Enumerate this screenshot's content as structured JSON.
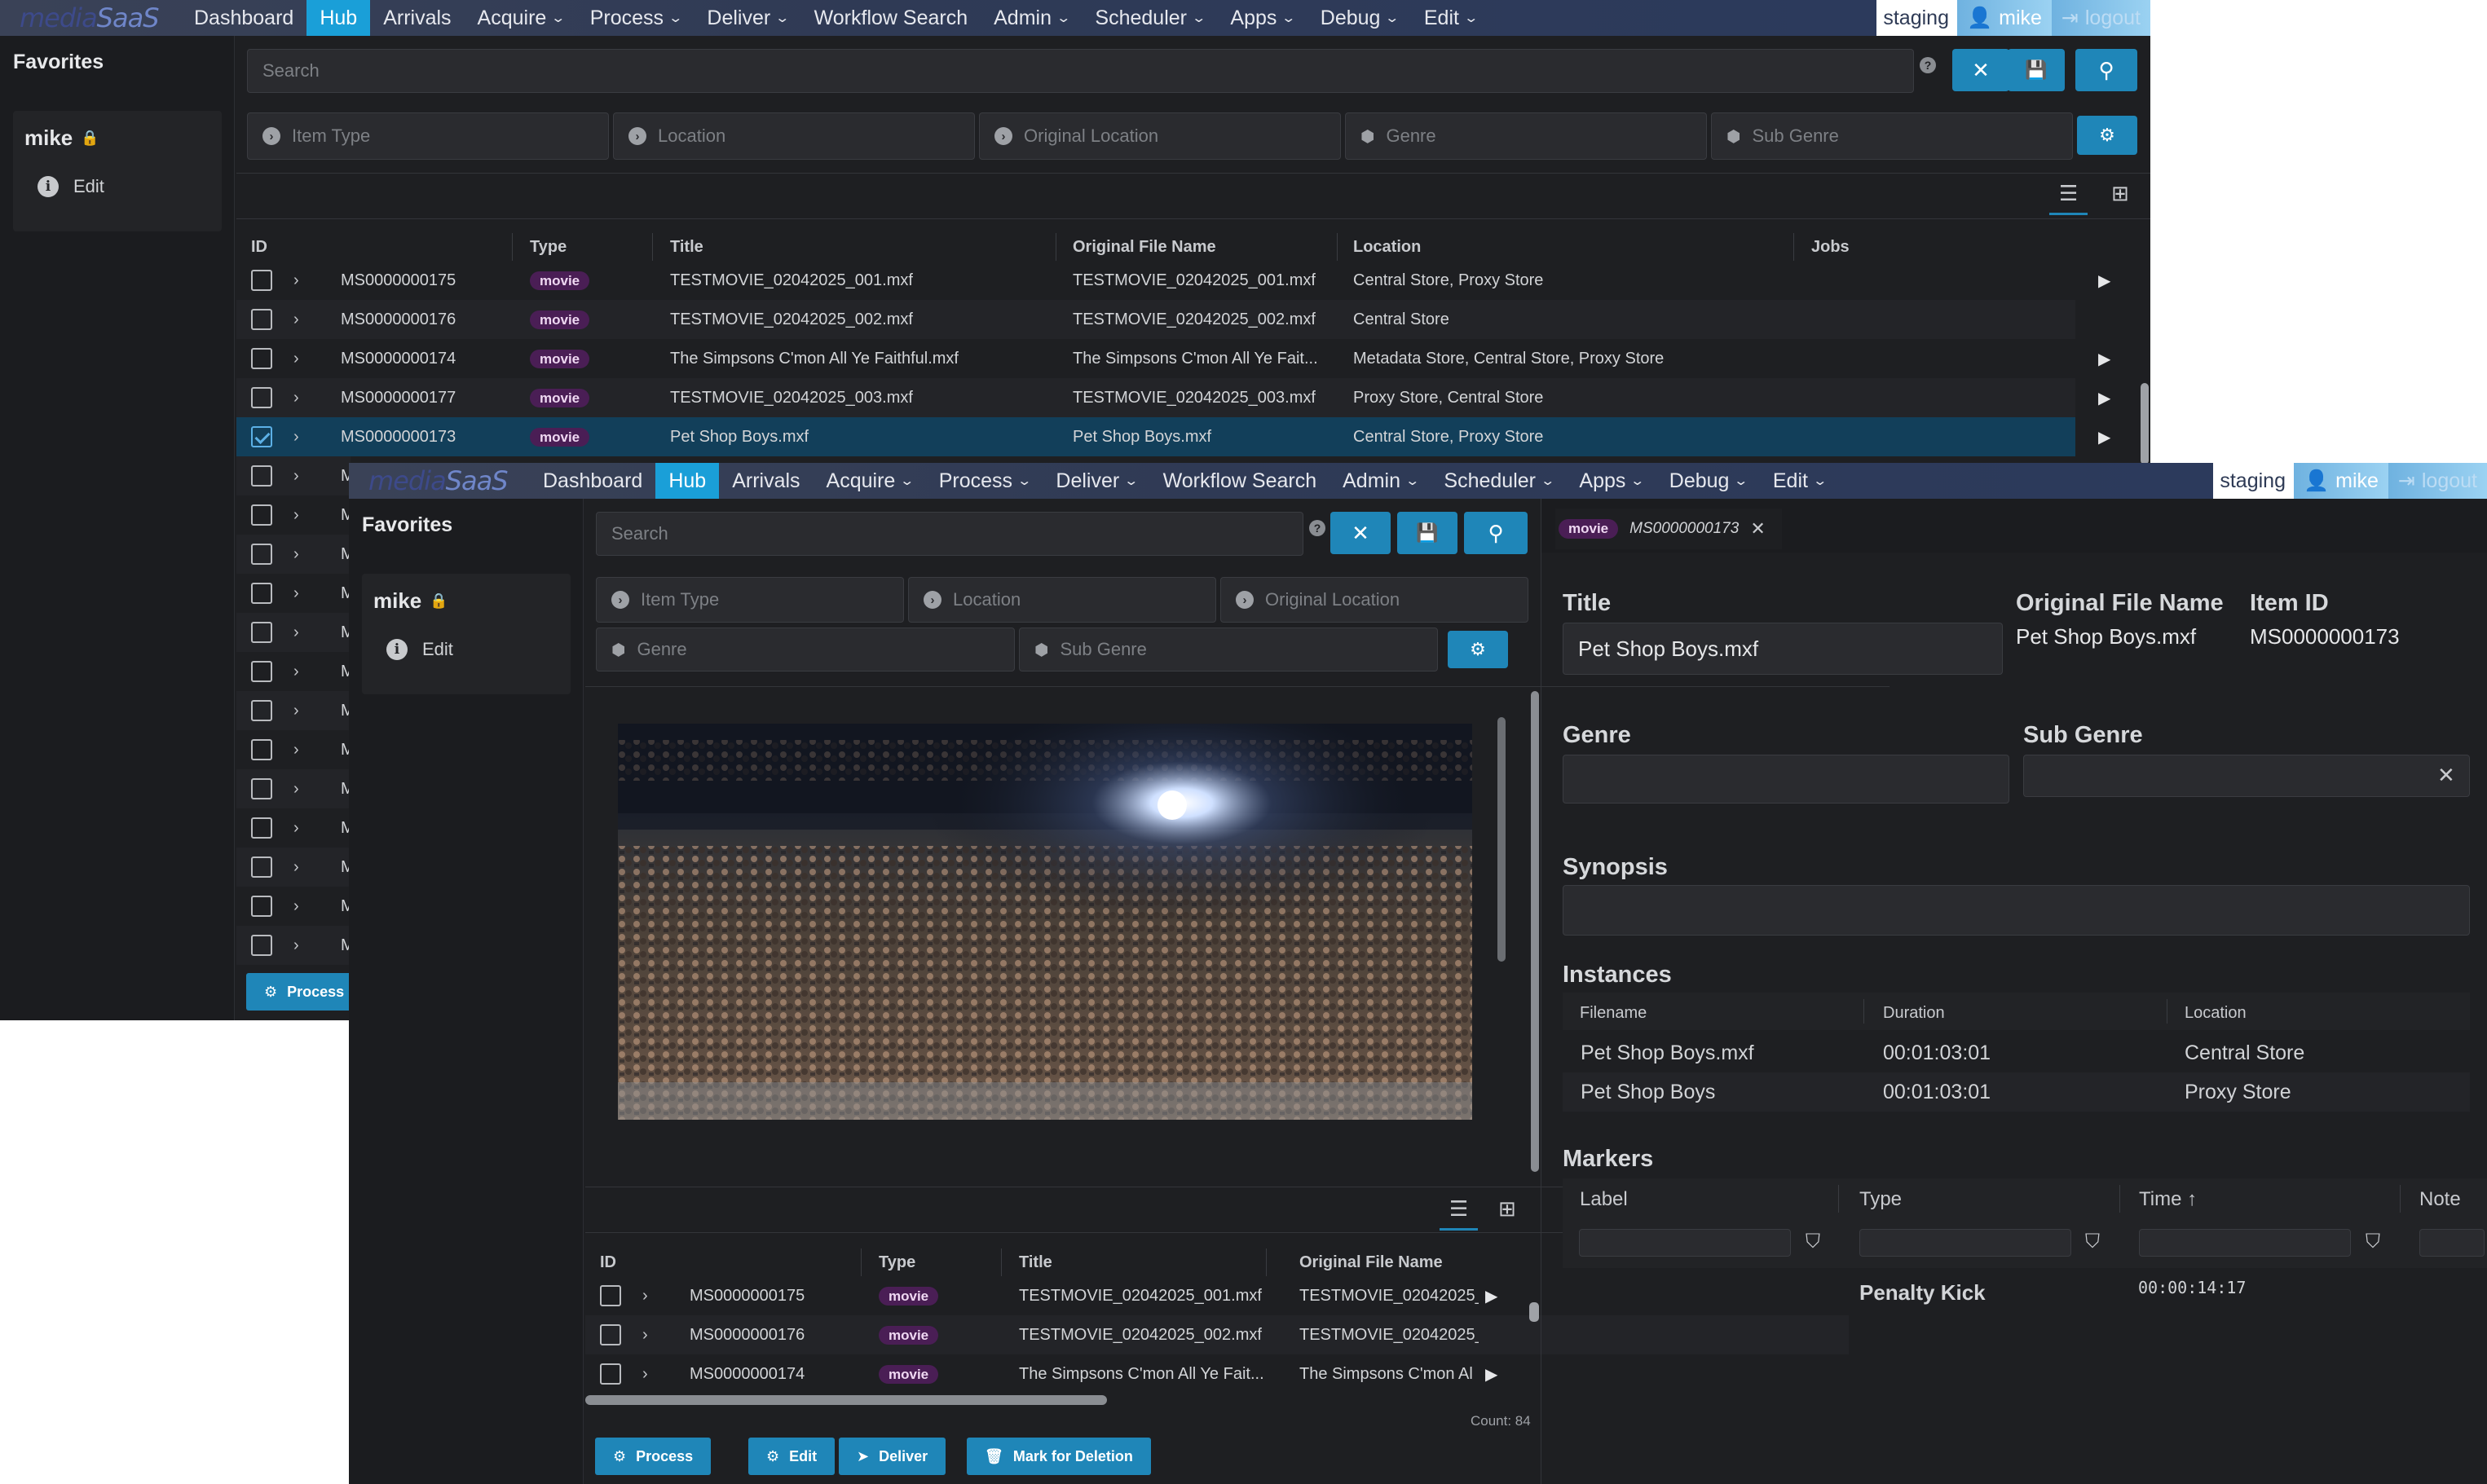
{
  "nav": {
    "logo_part1": "media",
    "logo_part2": "SaaS",
    "items": [
      {
        "label": "Dashboard",
        "has_menu": false
      },
      {
        "label": "Hub",
        "has_menu": false,
        "active": true
      },
      {
        "label": "Arrivals",
        "has_menu": false
      },
      {
        "label": "Acquire",
        "has_menu": true
      },
      {
        "label": "Process",
        "has_menu": true
      },
      {
        "label": "Deliver",
        "has_menu": true
      },
      {
        "label": "Workflow Search",
        "has_menu": false
      },
      {
        "label": "Admin",
        "has_menu": true
      },
      {
        "label": "Scheduler",
        "has_menu": true
      },
      {
        "label": "Apps",
        "has_menu": true
      },
      {
        "label": "Debug",
        "has_menu": true
      },
      {
        "label": "Edit",
        "has_menu": true
      }
    ],
    "environment": "staging",
    "user": "mike",
    "logout": "logout"
  },
  "sidebar": {
    "title": "Favorites",
    "user": "mike",
    "edit": "Edit"
  },
  "search": {
    "placeholder": "Search",
    "help": "?"
  },
  "filters": {
    "item_type": "Item Type",
    "location": "Location",
    "original_location": "Original Location",
    "genre": "Genre",
    "sub_genre": "Sub Genre"
  },
  "table": {
    "columns": {
      "id": "ID",
      "type": "Type",
      "title": "Title",
      "original_file_name": "Original File Name",
      "location": "Location",
      "jobs": "Jobs"
    },
    "rows": [
      {
        "id": "MS0000000175",
        "type": "movie",
        "title": "TESTMOVIE_02042025_001.mxf",
        "original": "TESTMOVIE_02042025_001.mxf",
        "location": "Central Store, Proxy Store",
        "play": true
      },
      {
        "id": "MS0000000176",
        "type": "movie",
        "title": "TESTMOVIE_02042025_002.mxf",
        "original": "TESTMOVIE_02042025_002.mxf",
        "location": "Central Store",
        "play": false
      },
      {
        "id": "MS0000000174",
        "type": "movie",
        "title": "The Simpsons C'mon All Ye Faithful.mxf",
        "original": "The Simpsons C'mon All Ye Fait...",
        "location": "Metadata Store, Central Store, Proxy Store",
        "play": true
      },
      {
        "id": "MS0000000177",
        "type": "movie",
        "title": "TESTMOVIE_02042025_003.mxf",
        "original": "TESTMOVIE_02042025_003.mxf",
        "location": "Proxy Store, Central Store",
        "play": true
      },
      {
        "id": "MS0000000173",
        "type": "movie",
        "title": "Pet Shop Boys.mxf",
        "original": "Pet Shop Boys.mxf",
        "location": "Central Store, Proxy Store",
        "play": true,
        "selected": true
      }
    ],
    "partial_id_char": "M",
    "process_button": "Process"
  },
  "front": {
    "rows": [
      {
        "id": "MS0000000175",
        "type": "movie",
        "title": "TESTMOVIE_02042025_001.mxf",
        "original": "TESTMOVIE_02042025_("
      },
      {
        "id": "MS0000000176",
        "type": "movie",
        "title": "TESTMOVIE_02042025_002.mxf",
        "original": "TESTMOVIE_02042025_("
      },
      {
        "id": "MS0000000174",
        "type": "movie",
        "title": "The Simpsons C'mon All Ye Fait...",
        "original": "The Simpsons C'mon Al"
      }
    ],
    "count": "Count: 84",
    "actions": [
      "Process",
      "Edit",
      "Deliver",
      "Mark for Deletion"
    ]
  },
  "detail": {
    "tab_badge": "movie",
    "tab_id": "MS0000000173",
    "title_label": "Title",
    "title_value": "Pet Shop Boys.mxf",
    "original_label": "Original File Name",
    "original_value": "Pet Shop Boys.mxf",
    "item_id_label": "Item ID",
    "item_id_value": "MS0000000173",
    "genre_label": "Genre",
    "sub_genre_label": "Sub Genre",
    "synopsis_label": "Synopsis",
    "instances_label": "Instances",
    "instances_columns": {
      "filename": "Filename",
      "duration": "Duration",
      "location": "Location"
    },
    "instances": [
      {
        "filename": "Pet Shop Boys.mxf",
        "duration": "00:01:03:01",
        "location": "Central Store"
      },
      {
        "filename": "Pet Shop Boys",
        "duration": "00:01:03:01",
        "location": "Proxy Store"
      }
    ],
    "markers_label": "Markers",
    "markers_columns": {
      "label": "Label",
      "type": "Type",
      "time": "Time",
      "note": "Note"
    },
    "markers": [
      {
        "label": "Penalty Kick",
        "time": "00:00:14:17"
      }
    ]
  },
  "colors": {
    "accent": "#1f86b8",
    "nav_active": "#1a9fd8",
    "badge_bg": "#4a1e55",
    "selected_row": "#123f5a",
    "background": "#1e1f22"
  }
}
